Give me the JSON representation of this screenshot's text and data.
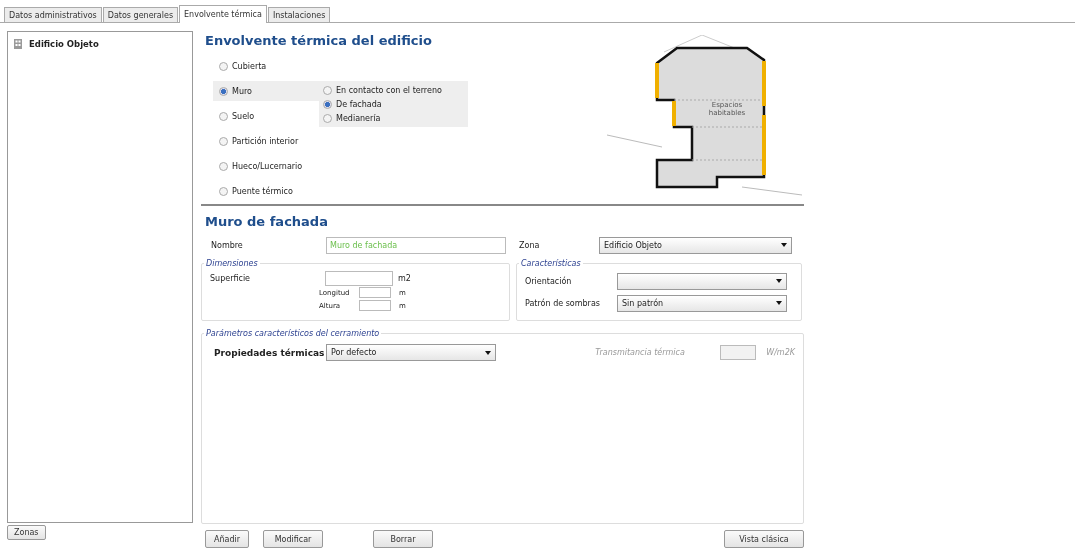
{
  "tabs": [
    {
      "label": "Datos administrativos",
      "selected": false
    },
    {
      "label": "Datos generales",
      "selected": false
    },
    {
      "label": "Envolvente térmica",
      "selected": true
    },
    {
      "label": "Instalaciones",
      "selected": false
    }
  ],
  "tree": {
    "items": [
      {
        "label": "Edificio Objeto"
      }
    ]
  },
  "zones_button": "Zonas",
  "envelope": {
    "title": "Envolvente térmica del edificio",
    "types": [
      {
        "label": "Cubierta",
        "selected": false
      },
      {
        "label": "Muro",
        "selected": true,
        "suboptions": [
          {
            "label": "En contacto con el terreno",
            "selected": false
          },
          {
            "label": "De fachada",
            "selected": true
          },
          {
            "label": "Medianería",
            "selected": false
          }
        ]
      },
      {
        "label": "Suelo",
        "selected": false
      },
      {
        "label": "Partición interior",
        "selected": false
      },
      {
        "label": "Hueco/Lucernario",
        "selected": false
      },
      {
        "label": "Puente térmico",
        "selected": false
      }
    ],
    "drawing_label": "Espacios habitables"
  },
  "wall": {
    "title": "Muro de fachada",
    "name_label": "Nombre",
    "name_value": "Muro de fachada",
    "zone_label": "Zona",
    "zone_value": "Edificio Objeto",
    "dimensions": {
      "legend": "Dimensiones",
      "surface_label": "Superficie",
      "surface_unit": "m2",
      "length_label": "Longitud",
      "length_unit": "m",
      "height_label": "Altura",
      "height_unit": "m"
    },
    "characteristics": {
      "legend": "Características",
      "orientation_label": "Orientación",
      "shading_label": "Patrón de sombras",
      "shading_value": "Sin patrón"
    }
  },
  "params": {
    "legend": "Parámetros característicos del cerramiento",
    "thermal_label": "Propiedades térmicas",
    "thermal_value": "Por defecto",
    "transmittance_label": "Transmitancia térmica",
    "transmittance_unit": "W/m2K"
  },
  "buttons": [
    {
      "label": "Añadir",
      "kind": "left"
    },
    {
      "label": "Modificar",
      "kind": "left"
    },
    {
      "label": "Borrar",
      "kind": "middle"
    },
    {
      "label": "Vista clásica",
      "kind": "right"
    }
  ]
}
